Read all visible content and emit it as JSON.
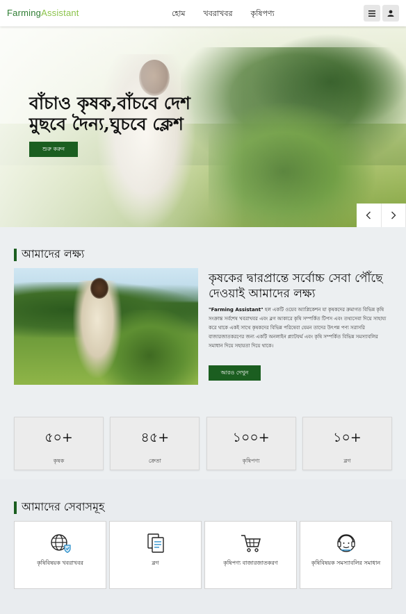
{
  "brand": {
    "part1": "Farming",
    "part2": "Assistant"
  },
  "nav": {
    "links": [
      "হোম",
      "খবরাখবর",
      "কৃষিপণ্য"
    ]
  },
  "hero": {
    "title_line1": "বাঁচাও কৃষক,বাঁচবে দেশ",
    "title_line2": "মুছবে দৈন্য,ঘুচবে ক্লেশ",
    "button": "শুরু করুন",
    "prev": "‹",
    "next": "›"
  },
  "about": {
    "heading": "আমাদের লক্ষ্য",
    "title": "কৃষকের দ্বারপ্রান্তে সর্বোচ্চ সেবা পৌঁছে দেওয়াই আমাদের লক্ষ্য",
    "brand_quote": "\"Farming Assistant\"",
    "text": " হল একটি ওয়েব অ্যাপ্লিকেশন যা কৃষকদের ক্রমাগত বিভিন্ন কৃষি সংক্রান্ত সর্বশেষ খবরাখবর এবং ব্লগ আকারে কৃষি সম্পর্কিত টিপস এবং তথ্যসেবা দিয়ে সাহায্য করে থাকে একই সাথে কৃষকদের বিভিন্ন পরিষেবা যেমন তাদের উৎপন্ন পণ্য সরাসরি বাজারজাতকরণের জন্য একটি অনলাইন প্ল্যাটফর্ম এবং কৃষি সম্পর্কিত বিভিন্ন সমস্যাবলির সমাধান দিয়ে সহায়তা দিয়ে থাকে।",
    "button": "আরও দেখুন"
  },
  "stats": [
    {
      "value": "৫০+",
      "label": "কৃষক"
    },
    {
      "value": "৪৫+",
      "label": "ক্রেতা"
    },
    {
      "value": "১০০+",
      "label": "কৃষিপণ্য"
    },
    {
      "value": "১০+",
      "label": "ব্লগ"
    }
  ],
  "services": {
    "heading": "আমাদের সেবাসমূহ",
    "items": [
      {
        "label": "কৃষিবিষয়ক খবরাখবর",
        "icon": "globe-icon"
      },
      {
        "label": "ব্লগ",
        "icon": "document-icon"
      },
      {
        "label": "কৃষিপণ্য বাজারজাতকরণ",
        "icon": "cart-icon"
      },
      {
        "label": "কৃষিবিষয়ক সমস্যাবলির সমাধান",
        "icon": "support-icon"
      }
    ]
  },
  "colors": {
    "primary": "#1b5e20",
    "brand_dark": "#2e7d32",
    "brand_light": "#8bc34a"
  }
}
